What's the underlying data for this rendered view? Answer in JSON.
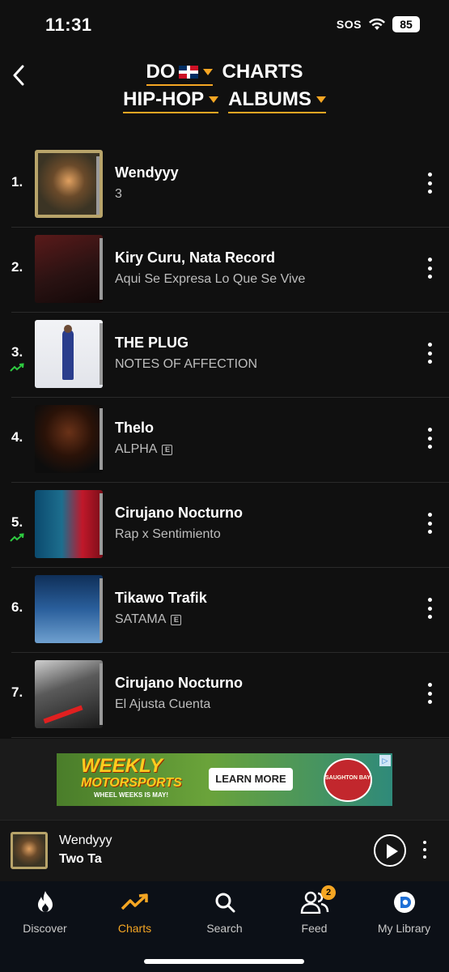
{
  "status_bar": {
    "time": "11:31",
    "sos": "SOS",
    "battery": "85"
  },
  "header": {
    "country": "DO",
    "charts_label": "CHARTS",
    "genre": "HIP-HOP",
    "type": "ALBUMS"
  },
  "chart": [
    {
      "rank": "1.",
      "artist": "Wendyyy",
      "album": "3",
      "explicit": false,
      "trending": false,
      "cover_colors": [
        "#3b3424",
        "#b8a46a"
      ]
    },
    {
      "rank": "2.",
      "artist": "Kiry Curu, Nata Record",
      "album": "Aqui Se Expresa Lo Que Se Vive",
      "explicit": false,
      "trending": false,
      "cover_colors": [
        "#2a1212",
        "#a02020"
      ]
    },
    {
      "rank": "3.",
      "artist": "THE PLUG",
      "album": "NOTES OF AFFECTION",
      "explicit": false,
      "trending": true,
      "cover_colors": [
        "#e6e8ee",
        "#2a3d8c"
      ]
    },
    {
      "rank": "4.",
      "artist": "Thelo",
      "album": "ALPHA",
      "explicit": true,
      "trending": false,
      "cover_colors": [
        "#0d0d0d",
        "#5a2a10"
      ]
    },
    {
      "rank": "5.",
      "artist": "Cirujano Nocturno",
      "album": "Rap x Sentimiento",
      "explicit": false,
      "trending": true,
      "cover_colors": [
        "#0b4a6e",
        "#c0182a"
      ]
    },
    {
      "rank": "6.",
      "artist": "Tikawo Trafik",
      "album": "SATAMA",
      "explicit": true,
      "trending": false,
      "cover_colors": [
        "#123a6c",
        "#6fa0cf"
      ]
    },
    {
      "rank": "7.",
      "artist": "Cirujano Nocturno",
      "album": "El Ajusta Cuenta",
      "explicit": false,
      "trending": false,
      "cover_colors": [
        "#1a1a1a",
        "#b0b0b0"
      ]
    }
  ],
  "explicit_mark": "E",
  "ad": {
    "headline": "WEEKLY",
    "headline2": "MOTORSPORTS",
    "sub": "WHEEL WEEKS IS MAY!",
    "cta": "LEARN MORE",
    "logo": "SAUGHTON BAY"
  },
  "player": {
    "artist": "Wendyyy",
    "track": "Two Ta"
  },
  "tabs": [
    {
      "label": "Discover",
      "icon": "flame-icon"
    },
    {
      "label": "Charts",
      "icon": "trending-icon"
    },
    {
      "label": "Search",
      "icon": "search-icon"
    },
    {
      "label": "Feed",
      "icon": "people-icon",
      "badge": "2"
    },
    {
      "label": "My Library",
      "icon": "library-icon"
    }
  ],
  "colors": {
    "accent": "#f5a623",
    "background": "#101010",
    "trend_green": "#2ecc40"
  }
}
